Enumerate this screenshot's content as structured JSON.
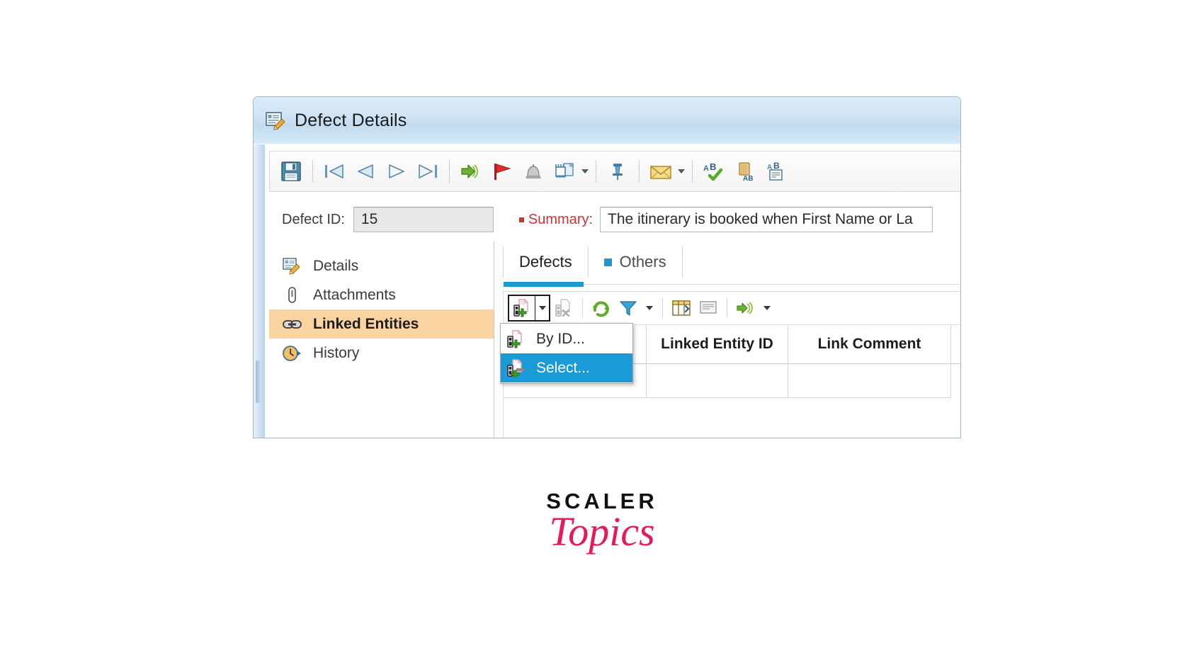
{
  "window": {
    "title": "Defect Details",
    "title_icon": "defect-details-icon"
  },
  "toolbar": {
    "buttons": [
      {
        "name": "save-button",
        "icon": "floppy-disk-icon",
        "label": "Save"
      },
      {
        "name": "first-button",
        "icon": "first-record-icon",
        "label": "First"
      },
      {
        "name": "previous-button",
        "icon": "previous-record-icon",
        "label": "Previous"
      },
      {
        "name": "next-button",
        "icon": "next-record-icon",
        "label": "Next"
      },
      {
        "name": "last-button",
        "icon": "last-record-icon",
        "label": "Last"
      },
      {
        "name": "send-button",
        "icon": "green-arrow-icon",
        "label": "Send"
      },
      {
        "name": "flag-button",
        "icon": "red-flag-icon",
        "label": "Flag for Follow Up"
      },
      {
        "name": "alert-button",
        "icon": "grey-bell-icon",
        "label": "Alerts"
      },
      {
        "name": "attach-button",
        "icon": "attach-document-icon",
        "label": "Attach"
      },
      {
        "name": "pin-button",
        "icon": "pin-icon",
        "label": "Pin"
      },
      {
        "name": "mail-button",
        "icon": "envelope-icon",
        "label": "Send by E-mail"
      },
      {
        "name": "spellcheck-button",
        "icon": "spell-check-icon",
        "label": "Check Spelling"
      },
      {
        "name": "thesaurus-button",
        "icon": "thesaurus-icon",
        "label": "Thesaurus"
      },
      {
        "name": "spelling-options-button",
        "icon": "spelling-options-icon",
        "label": "Spelling Options"
      }
    ]
  },
  "fields": {
    "defect_id_label": "Defect ID:",
    "defect_id_value": "15",
    "summary_label": "Summary:",
    "summary_value": "The itinerary is booked when First Name or La"
  },
  "sidebar": {
    "items": [
      {
        "label": "Details",
        "icon": "details-icon",
        "active": false
      },
      {
        "label": "Attachments",
        "icon": "paperclip-icon",
        "active": false
      },
      {
        "label": "Linked Entities",
        "icon": "chain-link-icon",
        "active": true
      },
      {
        "label": "History",
        "icon": "history-clock-icon",
        "active": false
      }
    ]
  },
  "tabs": [
    {
      "label": "Defects",
      "active": true,
      "marker": false
    },
    {
      "label": "Others",
      "active": false,
      "marker": true
    }
  ],
  "inner_toolbar": {
    "buttons": [
      {
        "name": "link-entity-button",
        "icon": "link-add-icon",
        "label": "Link Entity",
        "pressed": true
      },
      {
        "name": "remove-link-button",
        "icon": "link-remove-icon",
        "label": "Remove Link",
        "disabled": true
      },
      {
        "name": "refresh-button",
        "icon": "refresh-green-icon",
        "label": "Refresh All"
      },
      {
        "name": "filter-button",
        "icon": "filter-funnel-icon",
        "label": "Set Filter/Sort"
      },
      {
        "name": "columns-button",
        "icon": "select-columns-icon",
        "label": "Select Columns"
      },
      {
        "name": "comment-button",
        "icon": "comment-panel-icon",
        "label": "Show Comments"
      },
      {
        "name": "go-to-button",
        "icon": "go-to-entity-icon",
        "label": "Go To Entity"
      }
    ]
  },
  "menu": {
    "items": [
      {
        "label": "By ID...",
        "icon": "link-by-id-icon",
        "selected": false
      },
      {
        "label": "Select...",
        "icon": "link-select-icon",
        "selected": true
      }
    ]
  },
  "grid": {
    "columns": [
      "",
      "Linked Entity ID",
      "Link Comment"
    ]
  },
  "branding": {
    "name": "SCALER",
    "product": "Topics"
  },
  "colors": {
    "accent_blue": "#1b9ad6",
    "selection_orange": "#fad3a0",
    "required_red": "#cc3333",
    "brand_pink": "#e5195f"
  }
}
